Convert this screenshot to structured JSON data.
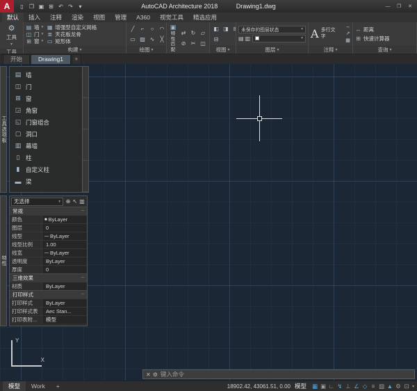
{
  "title_bar": {
    "logo_letter": "A",
    "app_title": "AutoCAD Architecture 2018",
    "doc_title": "Drawing1.dwg",
    "quick_access": [
      {
        "name": "new-icon",
        "glyph": "▯"
      },
      {
        "name": "open-icon",
        "glyph": "❐"
      },
      {
        "name": "save-icon",
        "glyph": "▣"
      },
      {
        "name": "plot-icon",
        "glyph": "⊞"
      },
      {
        "name": "undo-icon",
        "glyph": "↶"
      },
      {
        "name": "redo-icon",
        "glyph": "↷"
      },
      {
        "name": "qat-dropdown-icon",
        "glyph": "▾"
      }
    ],
    "window_buttons": [
      {
        "name": "minimize-icon",
        "glyph": "—"
      },
      {
        "name": "maximize-icon",
        "glyph": "❐"
      },
      {
        "name": "close-icon",
        "glyph": "✕"
      }
    ]
  },
  "menu_tabs": [
    {
      "label": "默认",
      "active": true
    },
    {
      "label": "插入"
    },
    {
      "label": "注释"
    },
    {
      "label": "渲染"
    },
    {
      "label": "视图"
    },
    {
      "label": "管理"
    },
    {
      "label": "A360"
    },
    {
      "label": "视觉工具"
    },
    {
      "label": "精选应用"
    }
  ],
  "ribbon": {
    "panel_arrow": "▾",
    "split_arrow": "▾",
    "tool": {
      "label": "工具",
      "button_label": "工具",
      "button_icon_glyph": "⚙"
    },
    "build": {
      "label": "构建",
      "primary": [
        {
          "name": "wall-icon",
          "glyph": "▤",
          "label": "墙"
        },
        {
          "name": "door-icon",
          "glyph": "◫",
          "label": "门"
        },
        {
          "name": "window-icon",
          "glyph": "⊞",
          "label": "窗"
        }
      ],
      "secondary": [
        {
          "name": "custom-grid-icon",
          "glyph": "▦",
          "label": "增强型自定义网格"
        },
        {
          "name": "ceiling-grid-icon",
          "glyph": "≣",
          "label": "天花板龙骨"
        },
        {
          "name": "box-icon",
          "glyph": "▭",
          "label": "矩形体"
        }
      ]
    },
    "draw": {
      "label": "绘图",
      "tools": [
        {
          "name": "line-icon",
          "glyph": "╱"
        },
        {
          "name": "polyline-icon",
          "glyph": "⌐"
        },
        {
          "name": "circle-icon",
          "glyph": "○"
        },
        {
          "name": "arc-icon",
          "glyph": "◠"
        },
        {
          "name": "rectangle-icon",
          "glyph": "▭"
        },
        {
          "name": "hatch-icon",
          "glyph": "▨"
        },
        {
          "name": "spline-icon",
          "glyph": "∿"
        },
        {
          "name": "erase-icon",
          "glyph": "╳"
        }
      ]
    },
    "modify": {
      "label": "修改",
      "match_label": "特性匹配",
      "match_icon_glyph": "▣",
      "tools": [
        {
          "name": "move-icon",
          "glyph": "⇄"
        },
        {
          "name": "rotate-icon",
          "glyph": "↻"
        },
        {
          "name": "stretch-icon",
          "glyph": "▱"
        },
        {
          "name": "offset-icon",
          "glyph": "⊘"
        },
        {
          "name": "trim-icon",
          "glyph": "✂"
        },
        {
          "name": "mirror-icon",
          "glyph": "◫"
        }
      ]
    },
    "view": {
      "label": "视图",
      "tools": [
        {
          "name": "view-left-icon",
          "glyph": "◧"
        },
        {
          "name": "view-right-icon",
          "glyph": "◨"
        },
        {
          "name": "viewport-icon",
          "glyph": "⊞"
        },
        {
          "name": "zoom-icon",
          "glyph": "⊟"
        }
      ]
    },
    "layers": {
      "label": "图层",
      "state_dropdown": "未保存的图层状态",
      "tools": [
        {
          "name": "layer-properties-icon",
          "glyph": "▤"
        },
        {
          "name": "layer-match-icon",
          "glyph": "▥"
        }
      ]
    },
    "annotate": {
      "label": "注释",
      "mtext_glyph": "A",
      "mtext_label": "多行文字",
      "tools": [
        {
          "name": "dimension-icon",
          "glyph": "↔"
        },
        {
          "name": "leader-icon",
          "glyph": "↗"
        },
        {
          "name": "table-icon",
          "glyph": "▦"
        }
      ]
    },
    "inquiry": {
      "label": "查询",
      "items": [
        {
          "name": "measure-distance-icon",
          "glyph": "↔",
          "label": "距离"
        },
        {
          "name": "quick-calc-icon",
          "glyph": "⊞",
          "label": "快速计算器"
        }
      ]
    }
  },
  "file_tabs": [
    {
      "label": "开始"
    },
    {
      "label": "Drawing1",
      "active": true
    }
  ],
  "file_tab_add": "+",
  "tool_palette": {
    "side_title": "工具选项板",
    "items": [
      {
        "name": "wall-icon",
        "glyph": "▤",
        "label": "墙"
      },
      {
        "name": "door-icon",
        "glyph": "◫",
        "label": "门"
      },
      {
        "name": "window-icon",
        "glyph": "⊞",
        "label": "窗"
      },
      {
        "name": "corner-window-icon",
        "glyph": "◲",
        "label": "角窗"
      },
      {
        "name": "door-window-assembly-icon",
        "glyph": "◱",
        "label": "门窗组合"
      },
      {
        "name": "opening-icon",
        "glyph": "▢",
        "label": "洞口"
      },
      {
        "name": "curtain-wall-icon",
        "glyph": "▥",
        "label": "幕墙"
      },
      {
        "name": "column-icon",
        "glyph": "▯",
        "label": "柱"
      },
      {
        "name": "custom-column-icon",
        "glyph": "▮",
        "label": "自定义柱"
      },
      {
        "name": "beam-icon",
        "glyph": "▬",
        "label": "梁"
      }
    ]
  },
  "properties": {
    "side_title": "特性",
    "selection": "无选择",
    "dropdown_arrow": "▾",
    "head_icons": [
      {
        "name": "toggle-pickadd-icon",
        "glyph": "⊕"
      },
      {
        "name": "select-objects-icon",
        "glyph": "↖"
      },
      {
        "name": "quick-select-icon",
        "glyph": "▥"
      }
    ],
    "collapse_glyph": "−",
    "sections": [
      {
        "title": "常规",
        "rows": [
          {
            "label": "颜色",
            "value": "ByLayer",
            "prefix": "■"
          },
          {
            "label": "图层",
            "value": "0",
            "prefix": ""
          },
          {
            "label": "线型",
            "value": "ByLayer",
            "prefix": "—"
          },
          {
            "label": "线型比例",
            "value": "1.00",
            "prefix": ""
          },
          {
            "label": "线宽",
            "value": "ByLayer",
            "prefix": "—"
          },
          {
            "label": "透明度",
            "value": "ByLayer",
            "prefix": ""
          },
          {
            "label": "厚度",
            "value": "0",
            "prefix": ""
          }
        ]
      },
      {
        "title": "三维效果",
        "rows": [
          {
            "label": "材质",
            "value": "ByLayer",
            "prefix": ""
          }
        ]
      },
      {
        "title": "打印样式",
        "rows": [
          {
            "label": "打印样式",
            "value": "ByLayer",
            "prefix": ""
          },
          {
            "label": "打印样式表",
            "value": "Aec Stan...",
            "prefix": ""
          },
          {
            "label": "打印表附...",
            "value": "模型",
            "prefix": ""
          }
        ]
      }
    ]
  },
  "ucs": {
    "x_label": "X",
    "y_label": "Y"
  },
  "command_line": {
    "placeholder": "键入命令",
    "icons": [
      {
        "name": "close-icon",
        "glyph": "✕"
      },
      {
        "name": "customize-icon",
        "glyph": "⚙"
      }
    ]
  },
  "status_bar": {
    "layout_tabs": [
      {
        "label": "模型",
        "active": true
      },
      {
        "label": "Work"
      },
      {
        "label": "+"
      }
    ],
    "coordinates": "18902.42, 43061.51, 0.00",
    "model_label": "模型",
    "toggles": [
      {
        "name": "grid-icon",
        "glyph": "▦",
        "active": true
      },
      {
        "name": "snap-icon",
        "glyph": "▣",
        "active": false
      },
      {
        "name": "infer-icon",
        "glyph": "∟",
        "active": false
      },
      {
        "name": "dynamic-input-icon",
        "glyph": "↯",
        "active": true
      },
      {
        "name": "ortho-icon",
        "glyph": "⊥",
        "active": false
      },
      {
        "name": "polar-icon",
        "glyph": "∠",
        "active": true
      },
      {
        "name": "osnap-icon",
        "glyph": "◇",
        "active": true
      },
      {
        "name": "lineweight-icon",
        "glyph": "≡",
        "active": false
      },
      {
        "name": "transparency-icon",
        "glyph": "▨",
        "active": false
      },
      {
        "name": "annotation-scale-icon",
        "glyph": "▲",
        "active": true
      },
      {
        "name": "workspace-gear-icon",
        "glyph": "⚙",
        "active": false
      },
      {
        "name": "clean-screen-icon",
        "glyph": "⊡",
        "active": false
      }
    ],
    "overflow_arrow": "▾"
  }
}
